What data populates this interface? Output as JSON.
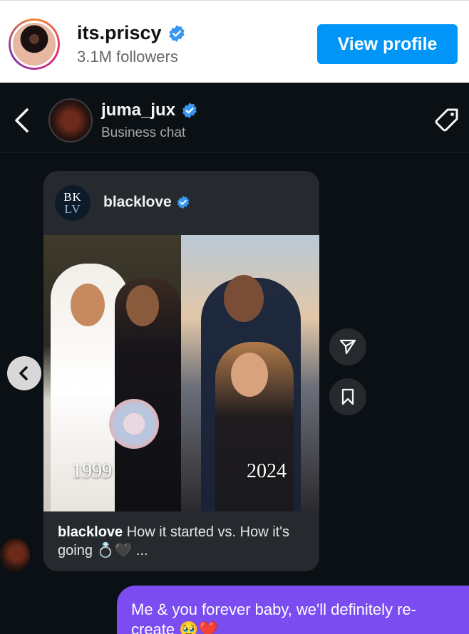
{
  "profile_header": {
    "username": "its.priscy",
    "followers": "3.1M followers",
    "view_profile_label": "View profile"
  },
  "chat_header": {
    "name": "juma_jux",
    "subtitle": "Business chat"
  },
  "shared_post": {
    "author": "blacklove",
    "logo_top": "BK",
    "logo_bottom": "LV",
    "year_left": "1999",
    "year_right": "2024",
    "caption_author": "blacklove",
    "caption_text": " How it started vs. How it's going 💍🖤 ..."
  },
  "outgoing_message": {
    "text": "Me & you forever baby, we'll definitely re-create 🥹❤️"
  },
  "colors": {
    "accent_blue": "#0095f6",
    "bubble_purple": "#7b4cf0",
    "chat_bg": "#0b1014",
    "card_bg": "#262a2e"
  }
}
